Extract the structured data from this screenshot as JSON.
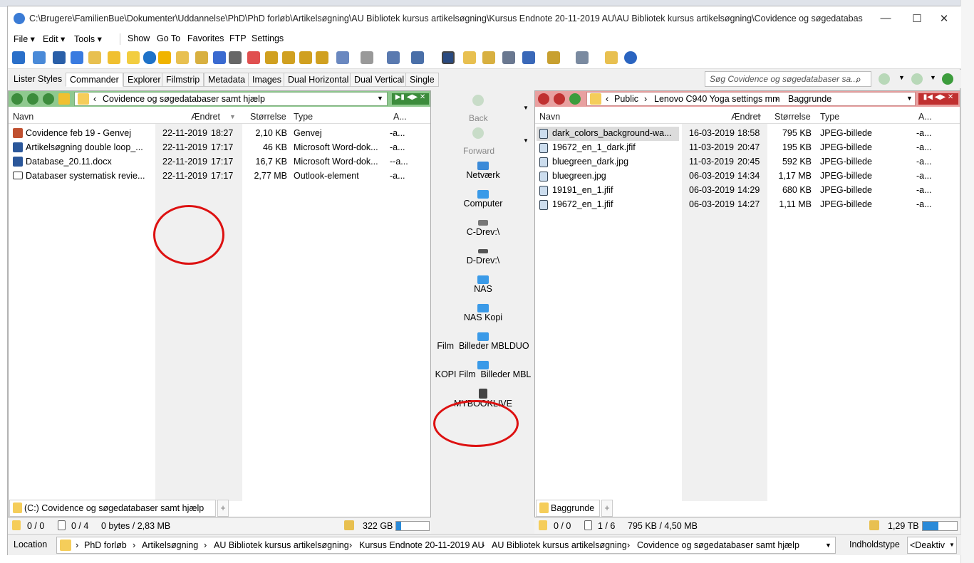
{
  "title": "C:\\Brugere\\FamilienBue\\Dokumenter\\Uddannelse\\PhD\\PhD forløb\\Artikelsøgning\\AU Bibliotek kursus artikelsøgning\\Kursus Endnote 20-11-2019 AU\\AU Bibliotek kursus artikelsøgning\\Covidence og søgedatabaser samt...",
  "menu": [
    "File",
    "Edit",
    "Tools",
    "Show",
    "Go To",
    "Favorites",
    "FTP",
    "Settings"
  ],
  "lister_styles": "Lister Styles",
  "tabs": [
    "Commander",
    "Explorer",
    "Filmstrip",
    "Metadata",
    "Images",
    "Dual Horizontal",
    "Dual Vertical",
    "Single"
  ],
  "search_placeholder": "Søg Covidence og søgedatabaser sa...",
  "left": {
    "path": "Covidence og søgedatabaser samt hjælp",
    "columns": [
      "Navn",
      "Ændret",
      "Størrelse",
      "Type",
      "A..."
    ],
    "files": [
      {
        "name": "Covidence feb 19 - Genvej",
        "date": "22-11-2019",
        "time": "18:27",
        "size": "2,10 KB",
        "type": "Genvej",
        "attr": "-a..."
      },
      {
        "name": "Artikelsøgning double loop_...",
        "date": "22-11-2019",
        "time": "17:17",
        "size": "46 KB",
        "type": "Microsoft Word-dok...",
        "attr": "-a..."
      },
      {
        "name": "Database_20.11.docx",
        "date": "22-11-2019",
        "time": "17:17",
        "size": "16,7 KB",
        "type": "Microsoft Word-dok...",
        "attr": "--a..."
      },
      {
        "name": "Databaser systematisk revie...",
        "date": "22-11-2019",
        "time": "17:17",
        "size": "2,77 MB",
        "type": "Outlook-element",
        "attr": "-a..."
      }
    ],
    "bottom_tab": "(C:) Covidence og søgedatabaser samt hjælp",
    "status": {
      "folders": "0 / 0",
      "files": "0 / 4",
      "bytes": "0 bytes / 2,83 MB",
      "free": "322 GB",
      "fill": 0.15
    }
  },
  "middle": {
    "back": "Back",
    "forward": "Forward",
    "items": [
      "Netværk",
      "Computer",
      "C-Drev:\\",
      "D-Drev:\\",
      "NAS",
      "NAS Kopi",
      "Film  Billeder MBLDUO",
      "KOPI Film  Billeder MBL",
      "MYBOOKLIVE"
    ]
  },
  "right": {
    "path": [
      "Public",
      "Lenovo C940 Yoga settings mm",
      "Baggrunde"
    ],
    "columns": [
      "Navn",
      "Ændret",
      "Størrelse",
      "Type",
      "A..."
    ],
    "files": [
      {
        "name": "dark_colors_background-wa...",
        "date": "16-03-2019",
        "time": "18:58",
        "size": "795 KB",
        "type": "JPEG-billede",
        "attr": "-a..."
      },
      {
        "name": "19672_en_1_dark.jfif",
        "date": "11-03-2019",
        "time": "20:47",
        "size": "195 KB",
        "type": "JPEG-billede",
        "attr": "-a..."
      },
      {
        "name": "bluegreen_dark.jpg",
        "date": "11-03-2019",
        "time": "20:45",
        "size": "592 KB",
        "type": "JPEG-billede",
        "attr": "-a..."
      },
      {
        "name": "bluegreen.jpg",
        "date": "06-03-2019",
        "time": "14:34",
        "size": "1,17 MB",
        "type": "JPEG-billede",
        "attr": "-a..."
      },
      {
        "name": "19191_en_1.jfif",
        "date": "06-03-2019",
        "time": "14:29",
        "size": "680 KB",
        "type": "JPEG-billede",
        "attr": "-a..."
      },
      {
        "name": "19672_en_1.jfif",
        "date": "06-03-2019",
        "time": "14:27",
        "size": "1,11 MB",
        "type": "JPEG-billede",
        "attr": "-a..."
      }
    ],
    "bottom_tab": "Baggrunde",
    "status": {
      "folders": "0 / 0",
      "files": "1 / 6",
      "bytes": "795 KB / 4,50 MB",
      "free": "1,29 TB",
      "fill": 0.45
    }
  },
  "location": {
    "label": "Location",
    "crumbs": [
      "PhD forløb",
      "Artikelsøgning",
      "AU Bibliotek kursus artikelsøgning",
      "Kursus Endnote 20-11-2019 AU",
      "AU Bibliotek kursus artikelsøgning",
      "Covidence og søgedatabaser samt hjælp"
    ],
    "content_type_label": "Indholdstype",
    "content_type_value": "<Deaktiv"
  },
  "colors": {
    "left_path": "#8fc98f",
    "right_path": "#e8a0a0",
    "accent_green": "#3c8c3c",
    "accent_red": "#c03030",
    "annotation": "#d11"
  }
}
